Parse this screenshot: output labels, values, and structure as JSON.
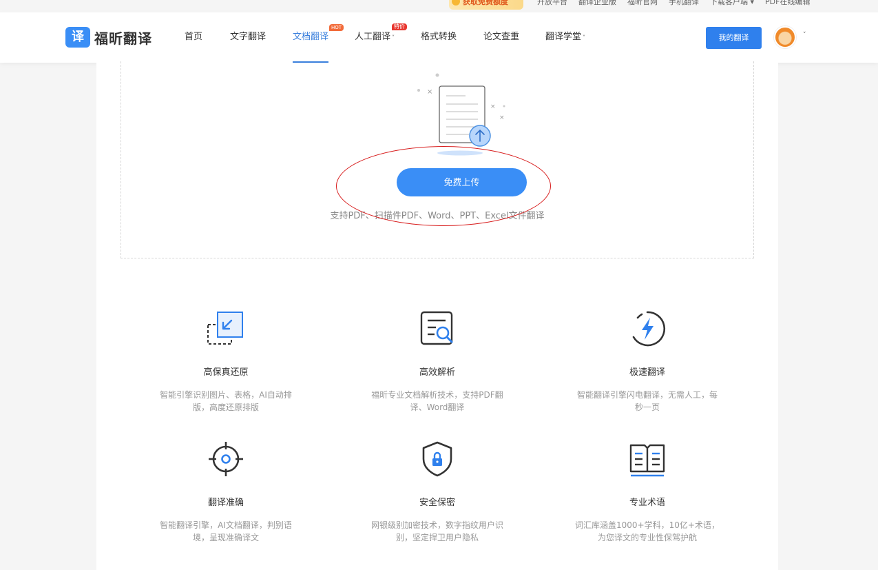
{
  "topbar": {
    "promo": "获取免费额度",
    "links": [
      "开放平台",
      "翻译企业版",
      "福昕官网",
      "手机翻译",
      "下载客户端 ▾",
      "PDF在线编辑"
    ]
  },
  "header": {
    "logo_badge": "译",
    "logo_text": "福昕翻译",
    "nav": [
      {
        "label": "首页"
      },
      {
        "label": "文字翻译"
      },
      {
        "label": "文档翻译",
        "badge": "HOT",
        "active": true
      },
      {
        "label": "人工翻译",
        "badge": "特价",
        "caret": "˅"
      },
      {
        "label": "格式转换"
      },
      {
        "label": "论文查重"
      },
      {
        "label": "翻译学堂",
        "caret": "˅"
      }
    ],
    "my_button": "我的翻译",
    "avatar_caret": "˅"
  },
  "upload": {
    "button": "免费上传",
    "hint": "支持PDF、扫描件PDF、Word、PPT、Excel文件翻译"
  },
  "features": [
    {
      "icon": "restore-frame-icon",
      "title": "高保真还原",
      "desc": "智能引擎识别图片、表格，AI自动排版，高度还原排版"
    },
    {
      "icon": "document-search-icon",
      "title": "高效解析",
      "desc": "福昕专业文档解析技术，支持PDF翻译、Word翻译"
    },
    {
      "icon": "lightning-icon",
      "title": "极速翻译",
      "desc": "智能翻译引擎闪电翻译，无需人工，每秒一页"
    },
    {
      "icon": "crosshair-icon",
      "title": "翻译准确",
      "desc": "智能翻译引擎，AI文档翻译，判别语境，呈现准确译文"
    },
    {
      "icon": "shield-lock-icon",
      "title": "安全保密",
      "desc": "网银级别加密技术，数字指纹用户识别，坚定捍卫用户隐私"
    },
    {
      "icon": "open-book-icon",
      "title": "专业术语",
      "desc": "词汇库涵盖1000+学科，10亿+术语，为您译文的专业性保驾护航"
    }
  ],
  "colors": {
    "accent": "#3a8ef6",
    "annotation": "#d81e1e"
  }
}
